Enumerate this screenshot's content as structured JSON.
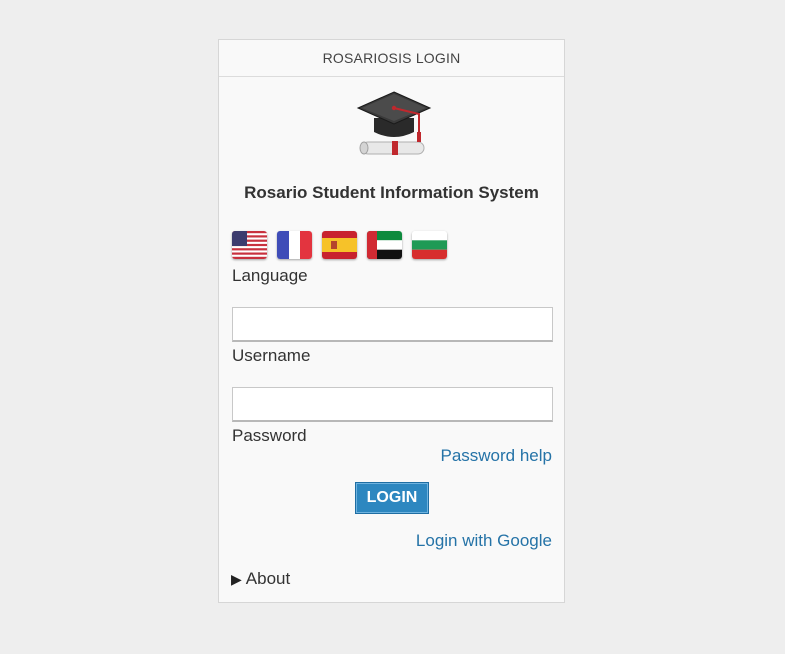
{
  "header": {
    "title": "ROSARIOSIS LOGIN"
  },
  "logo": {
    "icon": "graduation-cap-icon"
  },
  "system_title": "Rosario Student Information System",
  "languages": [
    {
      "code": "en",
      "icon": "us-flag-icon"
    },
    {
      "code": "fr",
      "icon": "france-flag-icon"
    },
    {
      "code": "es",
      "icon": "spain-flag-icon"
    },
    {
      "code": "ar",
      "icon": "uae-flag-icon"
    },
    {
      "code": "bg",
      "icon": "bulgaria-flag-icon"
    }
  ],
  "language_label": "Language",
  "username": {
    "label": "Username",
    "value": "",
    "placeholder": ""
  },
  "password": {
    "label": "Password",
    "value": "",
    "placeholder": ""
  },
  "password_help": "Password help",
  "login_button": "LOGIN",
  "google_login": "Login with Google",
  "about": {
    "label": "About",
    "icon": "triangle-right-icon"
  },
  "colors": {
    "accent": "#2d87c0",
    "link": "#2573a7",
    "background": "#eeeeee",
    "panel": "#f9f9f9"
  }
}
